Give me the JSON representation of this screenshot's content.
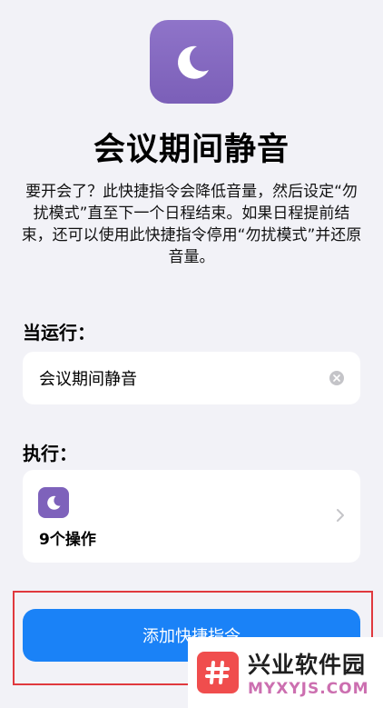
{
  "shortcut": {
    "title": "会议期间静音",
    "description": "要开会了？此快捷指令会降低音量，然后设定“勿扰模式”直至下一个日程结束。如果日程提前结束，还可以使用此快捷指令停用“勿扰模式”并还原音量。",
    "icon": "moon-icon",
    "color": "#7e62bb"
  },
  "trigger": {
    "label": "当运行：",
    "value": "会议期间静音"
  },
  "actions": {
    "label": "执行：",
    "count_label": "9个操作"
  },
  "add_button": {
    "label": "添加快捷指令",
    "color": "#1a82f7"
  },
  "watermark": {
    "text": "兴业软件园",
    "sub": "MYXYJS.COM"
  }
}
